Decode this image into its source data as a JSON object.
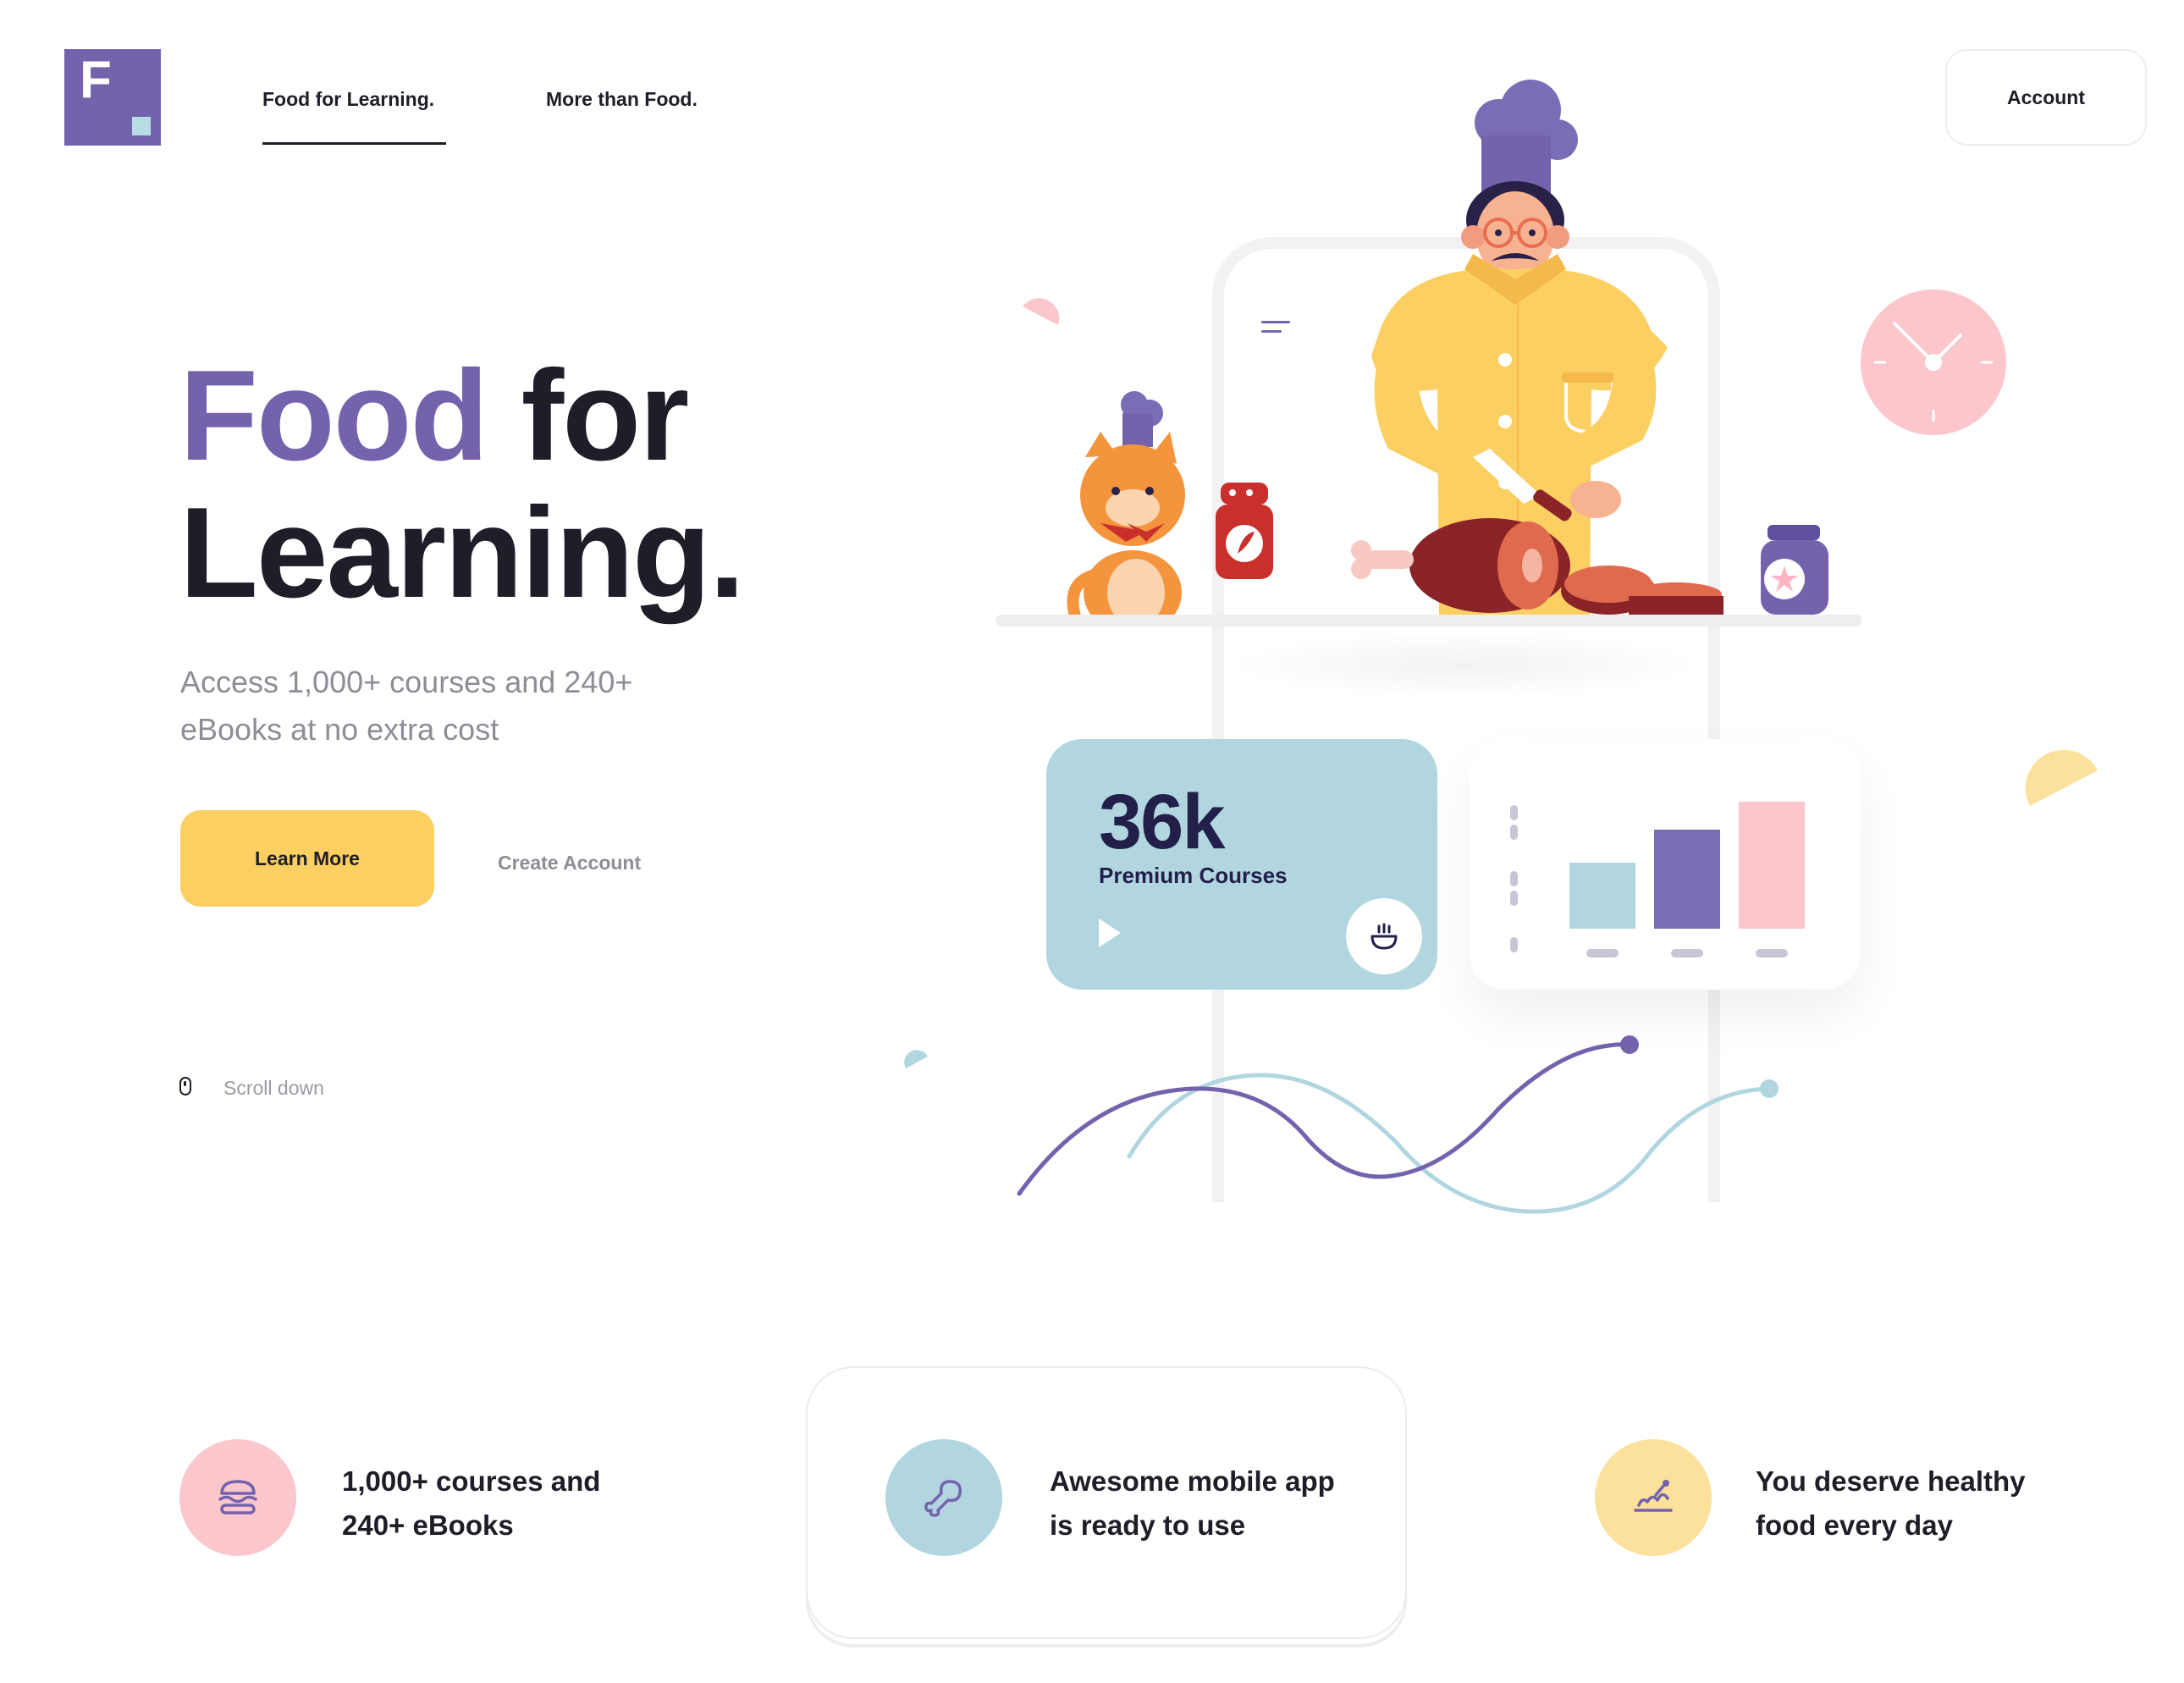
{
  "header": {
    "logo_letter": "F",
    "nav": [
      {
        "label": "Food for Learning.",
        "active": true
      },
      {
        "label": "More than Food.",
        "active": false
      }
    ],
    "account_label": "Account"
  },
  "hero": {
    "title_accent": "Food",
    "title_rest_line1": " for",
    "title_line2": "Learning.",
    "subtitle": "Access 1,000+ courses and 240+ eBooks at no extra cost",
    "primary_button": "Learn More",
    "secondary_link": "Create Account",
    "scroll_label": "Scroll down"
  },
  "stat_card": {
    "value": "36k",
    "label": "Premium Courses"
  },
  "mini_chart": {
    "type": "bar",
    "values": [
      36,
      54,
      69
    ],
    "colors": [
      "#b1d6df",
      "#7a6db5",
      "#fcc6cd"
    ]
  },
  "features": [
    {
      "icon": "burger-icon",
      "text": "1,000+ courses and 240+ eBooks",
      "color": "#fcc6cd"
    },
    {
      "icon": "drumstick-icon",
      "text": "Awesome mobile app is ready to use",
      "color": "#b1d6df"
    },
    {
      "icon": "healthy-food-icon",
      "text": "You deserve healthy food every day",
      "color": "#fbe19b"
    }
  ],
  "colors": {
    "brand_purple": "#7462ad",
    "accent_yellow": "#fccf62",
    "accent_blue": "#b1d6df",
    "accent_pink": "#fcc6cd",
    "text_dark": "#1e1e28",
    "text_muted": "#8d8d96"
  }
}
